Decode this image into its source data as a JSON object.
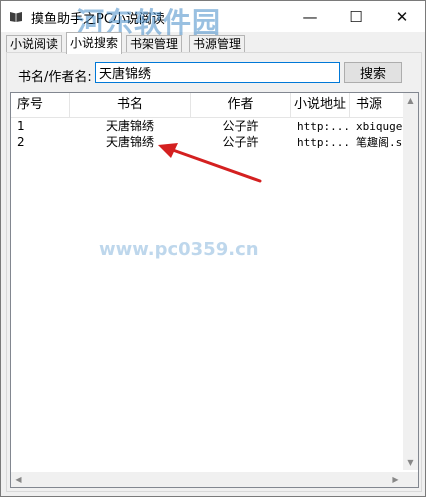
{
  "window": {
    "title": "摸鱼助手之PC小说阅读",
    "watermark": "河东软件园",
    "watermark_url": "www.pc0359.cn",
    "controls": {
      "minimize": "—",
      "maximize": "☐",
      "close": "✕"
    }
  },
  "tabs": [
    {
      "label": "小说阅读",
      "active": false
    },
    {
      "label": "小说搜索",
      "active": true
    },
    {
      "label": "书架管理",
      "active": false
    },
    {
      "label": "书源管理",
      "active": false
    }
  ],
  "search": {
    "label": "书名/作者名:",
    "value": "天唐锦绣",
    "button": "搜索"
  },
  "table": {
    "columns": [
      "序号",
      "书名",
      "作者",
      "小说地址",
      "书源"
    ],
    "rows": [
      [
        "1",
        "天唐锦绣",
        "公子許",
        "http:...",
        "xbiquge.la"
      ],
      [
        "2",
        "天唐锦绣",
        "公子許",
        "http:...",
        "笔趣阁.se"
      ]
    ]
  },
  "colors": {
    "focus": "#0078d7",
    "annotation_arrow": "#d42020"
  },
  "icons": {
    "app": "book-icon",
    "annotation": "red-arrow-icon"
  }
}
